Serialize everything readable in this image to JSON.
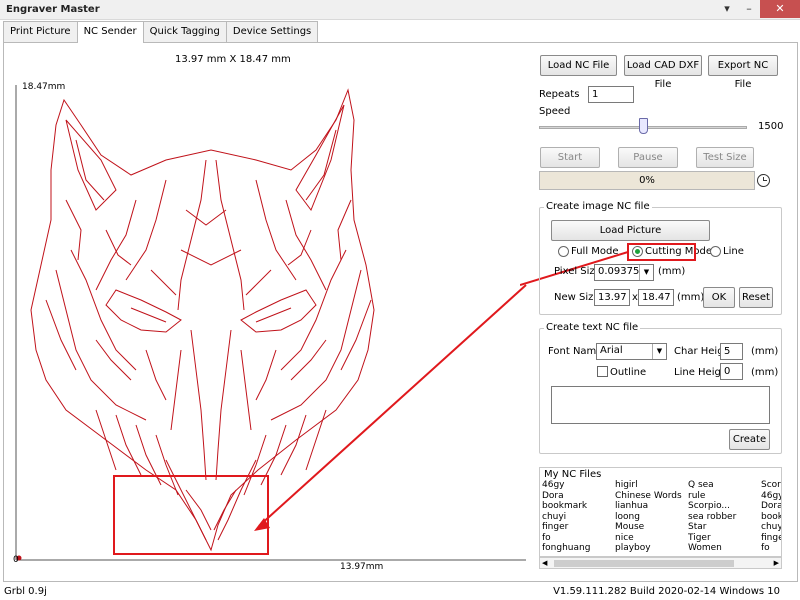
{
  "window": {
    "title": "Engraver Master",
    "controls": [
      "▾",
      "–",
      "✕"
    ]
  },
  "tabs": [
    {
      "label": "Print Picture"
    },
    {
      "label": "NC Sender"
    },
    {
      "label": "Quick Tagging"
    },
    {
      "label": "Device Settings"
    }
  ],
  "canvas": {
    "size_label": "13.97 mm X 18.47 mm",
    "y_top_label": "18.47mm",
    "y_origin_label": "0",
    "x_end_label": "13.97mm",
    "line_color": "#c0121a",
    "highlight_color": "#e0191d"
  },
  "toolbar": {
    "load_nc": "Load NC File",
    "load_cad": "Load CAD DXF File",
    "export_nc": "Export NC File"
  },
  "repeats": {
    "label": "Repeats",
    "value": "1"
  },
  "speed": {
    "label": "Speed",
    "value": "1500",
    "position": 0.5
  },
  "controls": {
    "start": "Start",
    "pause": "Pause",
    "test_size": "Test Size"
  },
  "progress": {
    "text": "0%"
  },
  "image_nc": {
    "group_title": "Create image NC file",
    "load_picture": "Load Picture",
    "modes": [
      {
        "label": "Full Mode",
        "selected": false
      },
      {
        "label": "Cutting Mode",
        "selected": true
      },
      {
        "label": "Line",
        "selected": false
      }
    ],
    "pixel_size_label": "Pixel Size",
    "pixel_size_value": "0.09375",
    "pixel_size_unit": "(mm)",
    "new_size_label": "New Size",
    "width": "13.97",
    "x": "x",
    "height": "18.47",
    "size_unit": "(mm)",
    "ok": "OK",
    "reset": "Reset"
  },
  "text_nc": {
    "group_title": "Create text NC file",
    "font_name_label": "Font Name",
    "font_value": "Arial",
    "char_height_label": "Char Height",
    "char_height_value": "5",
    "char_unit": "(mm)",
    "outline_label": "Outline",
    "line_height_label": "Line Height",
    "line_height_value": "0",
    "line_unit": "(mm)",
    "create": "Create"
  },
  "nc_files": {
    "title": "My NC Files",
    "items": [
      "46gy",
      "higirl",
      "Q sea",
      "Scorp",
      "Dora",
      "Chinese Words",
      "rule",
      "46gy",
      "bookmark",
      "lianhua",
      "Scorpio...",
      "Dora",
      "chuyi",
      "loong",
      "sea robber",
      "bookm",
      "finger",
      "Mouse",
      "Star",
      "chuyi",
      "fo",
      "nice",
      "Tiger",
      "finger",
      "fonghuang",
      "playboy",
      "Women",
      "fo"
    ]
  },
  "status": {
    "left": "Grbl 0.9j",
    "right": "V1.59.111.282 Build 2020-02-14 Windows 10"
  }
}
